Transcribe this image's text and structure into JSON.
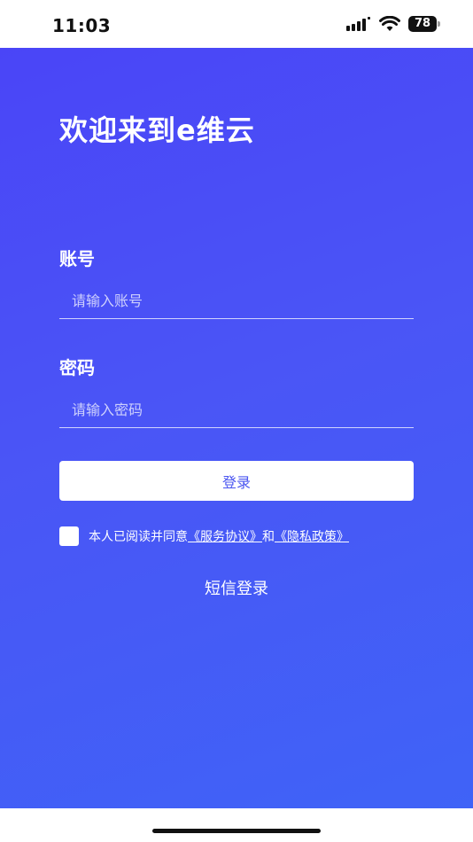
{
  "status_bar": {
    "time": "11:03",
    "battery": "78",
    "icons": [
      "signal-icon",
      "wifi-icon",
      "battery-icon"
    ]
  },
  "login": {
    "title": "欢迎来到e维云",
    "account": {
      "label": "账号",
      "placeholder": "请输入账号",
      "value": ""
    },
    "password": {
      "label": "密码",
      "placeholder": "请输入密码",
      "value": ""
    },
    "login_button": "登录",
    "agreement": {
      "checked": false,
      "prefix": "本人已阅读并同意",
      "service_link": "《服务协议》",
      "and": "和",
      "privacy_link": "《隐私政策》"
    },
    "sms_login": "短信登录"
  },
  "colors": {
    "gradient_start": "#4a45f7",
    "gradient_end": "#3f63f7",
    "button_text": "#4a55f0"
  }
}
